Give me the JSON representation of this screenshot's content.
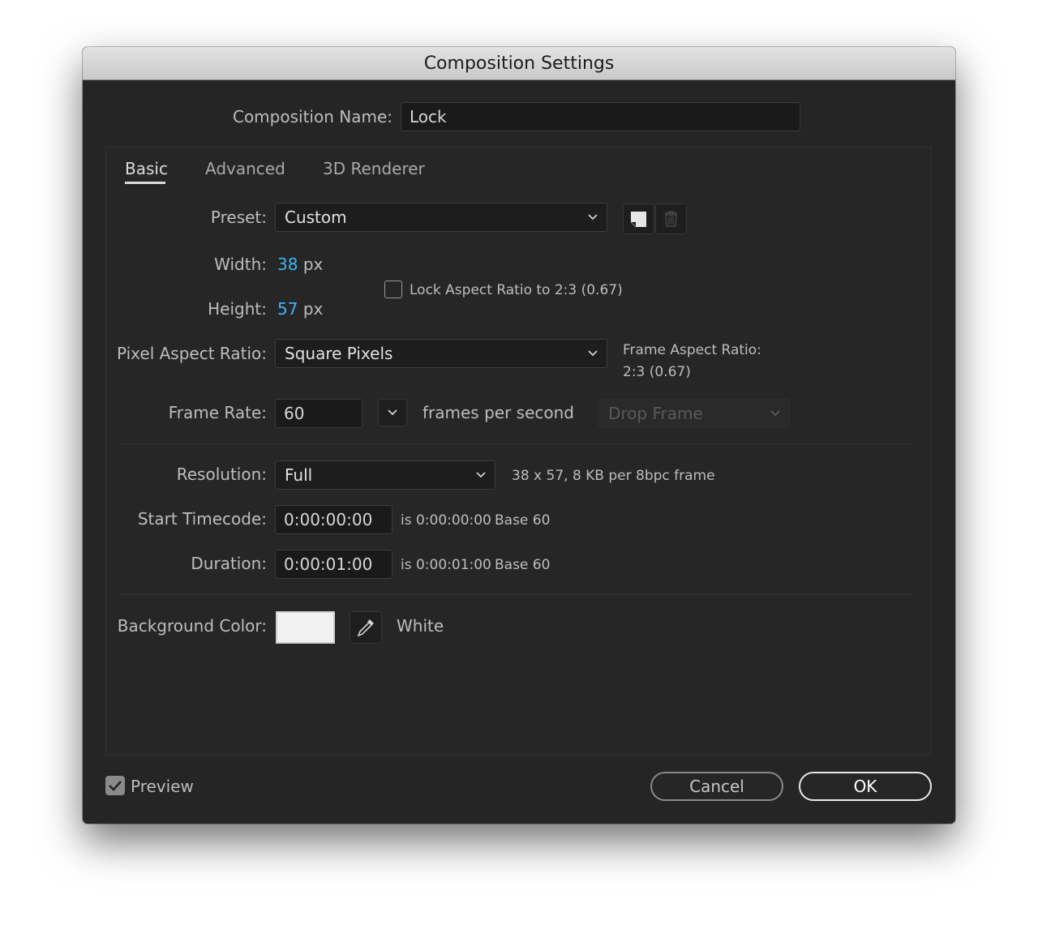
{
  "window": {
    "title": "Composition Settings"
  },
  "comp_name": {
    "label": "Composition Name:",
    "value": "Lock"
  },
  "tabs": [
    {
      "label": "Basic",
      "active": true
    },
    {
      "label": "Advanced",
      "active": false
    },
    {
      "label": "3D Renderer",
      "active": false
    }
  ],
  "preset": {
    "label": "Preset:",
    "value": "Custom"
  },
  "width": {
    "label": "Width:",
    "value": "38",
    "unit": "px"
  },
  "height": {
    "label": "Height:",
    "value": "57",
    "unit": "px"
  },
  "lock_aspect": {
    "label": "Lock Aspect Ratio to 2:3 (0.67)",
    "checked": false
  },
  "pixel_aspect": {
    "label": "Pixel Aspect Ratio:",
    "value": "Square Pixels"
  },
  "frame_aspect": {
    "label": "Frame Aspect Ratio:",
    "value": "2:3 (0.67)"
  },
  "frame_rate": {
    "label": "Frame Rate:",
    "value": "60",
    "unit_label": "frames per second",
    "drop_frame": "Drop Frame"
  },
  "resolution": {
    "label": "Resolution:",
    "value": "Full",
    "info": "38 x 57, 8 KB per 8bpc frame"
  },
  "start_timecode": {
    "label": "Start Timecode:",
    "value": "0:00:00:00",
    "is_text": "is 0:00:00:00",
    "base": "Base 60"
  },
  "duration": {
    "label": "Duration:",
    "value": "0:00:01:00",
    "is_text": "is 0:00:01:00",
    "base": "Base 60"
  },
  "background": {
    "label": "Background Color:",
    "color_name": "White",
    "swatch_color": "#f2f2f2"
  },
  "preview": {
    "label": "Preview",
    "checked": true
  },
  "buttons": {
    "cancel": "Cancel",
    "ok": "OK"
  },
  "colors": {
    "accent_value": "#3cb4f5",
    "window_bg": "#252525"
  }
}
